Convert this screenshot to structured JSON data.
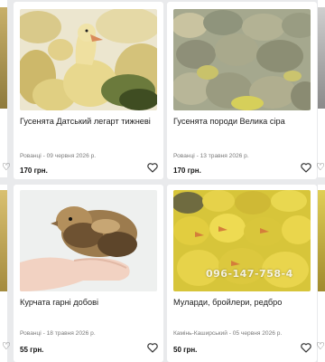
{
  "listings": [
    {
      "title": "Гусенята Датський легарт тижневі",
      "meta": "Рованці - 09 червня 2026 р.",
      "price": "170 грн."
    },
    {
      "title": "Гусенята породи Велика сіра",
      "meta": "Рованці - 13 травня 2026 р.",
      "price": "170 грн."
    },
    {
      "title": "Курчата гарні добові",
      "meta": "Рованці - 18 травня 2026 р.",
      "price": "55 грн."
    },
    {
      "title": "Муларди, бройлери, редбро",
      "meta": "Камінь-Каширський - 05 червня 2026 р.",
      "price": "50 грн.",
      "photo_watermark": "096-147-758-4"
    }
  ],
  "icons": {
    "favorite": "heart-outline-icon"
  },
  "colors": {
    "page_background": "#e9eaec",
    "card_background": "#ffffff",
    "price_text": "#111111"
  }
}
